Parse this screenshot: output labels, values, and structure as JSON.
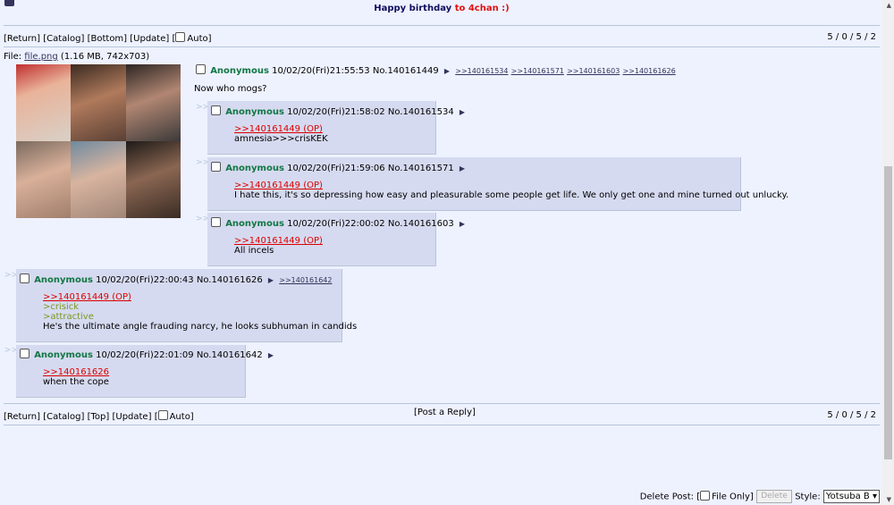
{
  "announcement": {
    "prefix": "Happy birthday ",
    "highlight": "to 4chan :)"
  },
  "nav_top": {
    "return": "[Return]",
    "catalog": "[Catalog]",
    "bottom": "[Bottom]",
    "update": "[Update]",
    "auto_open": "[",
    "auto_label": "Auto]",
    "stats": "5 / 0 / 5 / 2"
  },
  "op": {
    "file_prefix": "File: ",
    "file_name": "file.png",
    "file_meta": " (1.16 MB, 742x703)",
    "name": "Anonymous",
    "datetime": "10/02/20(Fri)21:55:53",
    "no": "No.140161449",
    "backlinks": [
      ">>140161534",
      ">>140161571",
      ">>140161603",
      ">>140161626"
    ],
    "message": "Now who mogs?"
  },
  "replies": [
    {
      "name": "Anonymous",
      "datetime": "10/02/20(Fri)21:58:02",
      "no": "No.140161534",
      "quote": ">>140161449 (OP)",
      "lines": [
        "amnesia>>>crisKEK"
      ]
    },
    {
      "name": "Anonymous",
      "datetime": "10/02/20(Fri)21:59:06",
      "no": "No.140161571",
      "quote": ">>140161449 (OP)",
      "lines": [
        "I hate this, it's so depressing how easy and pleasurable some people get life. We only get one and mine turned out unlucky."
      ]
    },
    {
      "name": "Anonymous",
      "datetime": "10/02/20(Fri)22:00:02",
      "no": "No.140161603",
      "quote": ">>140161449 (OP)",
      "lines": [
        "All incels"
      ]
    },
    {
      "name": "Anonymous",
      "datetime": "10/02/20(Fri)22:00:43",
      "no": "No.140161626",
      "backlink": ">>140161642",
      "quote": ">>140161449 (OP)",
      "green1": ">crisick",
      "green2": ">attractive",
      "lines": [
        "He's the ultimate angle frauding narcy, he looks subhuman in candids"
      ]
    },
    {
      "name": "Anonymous",
      "datetime": "10/02/20(Fri)22:01:09",
      "no": "No.140161642",
      "quote": ">>140161626",
      "lines": [
        "when the cope"
      ]
    }
  ],
  "nav_bottom": {
    "return": "[Return]",
    "catalog": "[Catalog]",
    "top": "[Top]",
    "update": "[Update]",
    "auto_open": "[",
    "auto_label": "Auto]",
    "post_reply": "[Post a Reply]",
    "stats": "5 / 0 / 5 / 2"
  },
  "footer": {
    "delete_post": "Delete Post: [",
    "file_only": "File Only]",
    "delete_btn": "Delete",
    "style_label": "Style:",
    "style_value": "Yotsuba B"
  },
  "colors": {
    "bg": "#eef2ff",
    "reply_bg": "#d6daf0",
    "name": "#117743",
    "quote": "#dd0000",
    "greentext": "#789922"
  }
}
